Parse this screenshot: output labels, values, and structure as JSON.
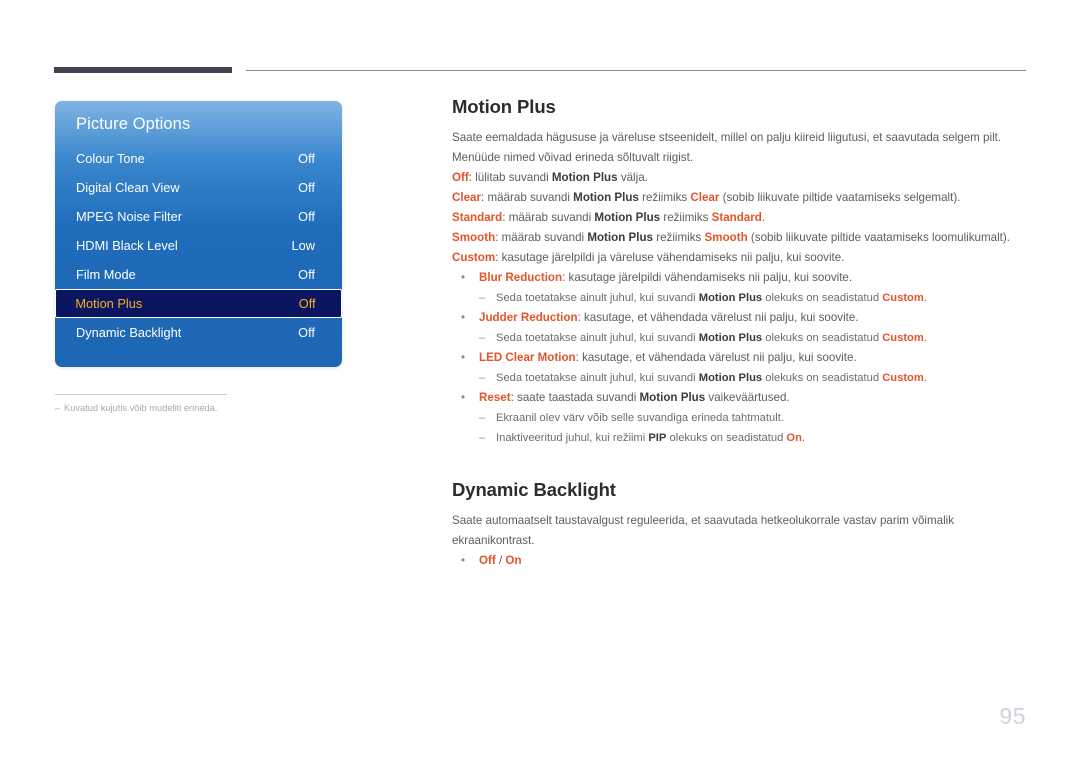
{
  "colors": {
    "accent": "#e4542b",
    "osd_selected_bg": "#0c1560",
    "osd_selected_text": "#f0b323",
    "header_bar": "#454350",
    "page_number": "#d2d2da"
  },
  "osd": {
    "title": "Picture Options",
    "rows": [
      {
        "label": "Colour Tone",
        "value": "Off",
        "selected": false
      },
      {
        "label": "Digital Clean View",
        "value": "Off",
        "selected": false
      },
      {
        "label": "MPEG Noise Filter",
        "value": "Off",
        "selected": false
      },
      {
        "label": "HDMI Black Level",
        "value": "Low",
        "selected": false
      },
      {
        "label": "Film Mode",
        "value": "Off",
        "selected": false
      },
      {
        "label": "Motion Plus",
        "value": "Off",
        "selected": true
      },
      {
        "label": "Dynamic Backlight",
        "value": "Off",
        "selected": false
      }
    ]
  },
  "footnote": {
    "dash": "–",
    "text": "Kuvatud kujutis võib mudeliti erineda."
  },
  "sections": {
    "motion_plus": {
      "heading": "Motion Plus",
      "intro_1": "Saate eemaldada hägususe ja väreluse stseenidelt, millel on palju kiireid liigutusi, et saavutada selgem pilt.",
      "intro_2": "Menüüde nimed võivad erineda sõltuvalt riigist.",
      "modes": [
        {
          "term": "Off",
          "mid": ": lülitab suvandi ",
          "ref": "Motion Plus",
          "tail": " välja."
        },
        {
          "term": "Clear",
          "mid": ": määrab suvandi ",
          "ref": "Motion Plus",
          "mid2": " režiimiks ",
          "term2": "Clear",
          "tail": " (sobib liikuvate piltide vaatamiseks selgemalt)."
        },
        {
          "term": "Standard",
          "mid": ": määrab suvandi ",
          "ref": "Motion Plus",
          "mid2": " režiimiks ",
          "term2": "Standard",
          "tail": "."
        },
        {
          "term": "Smooth",
          "mid": ": määrab suvandi ",
          "ref": "Motion Plus",
          "mid2": " režiimiks ",
          "term2": "Smooth",
          "tail": " (sobib liikuvate piltide vaatamiseks loomulikumalt)."
        },
        {
          "term": "Custom",
          "mid": ": kasutage järelpildi ja väreluse vähendamiseks nii palju, kui soovite.",
          "ref": "",
          "tail": ""
        }
      ],
      "bullets": [
        {
          "marker": "•",
          "term": "Blur Reduction",
          "text": ": kasutage järelpildi vähendamiseks nii palju, kui soovite.",
          "sub": [
            {
              "marker": "–",
              "pre": "Seda toetatakse ainult juhul, kui suvandi ",
              "ref": "Motion Plus",
              "mid": " olekuks on seadistatud ",
              "ref2": "Custom",
              "tail": "."
            }
          ]
        },
        {
          "marker": "•",
          "term": "Judder Reduction",
          "text": ": kasutage, et vähendada värelust nii palju, kui soovite.",
          "sub": [
            {
              "marker": "–",
              "pre": "Seda toetatakse ainult juhul, kui suvandi ",
              "ref": "Motion Plus",
              "mid": " olekuks on seadistatud ",
              "ref2": "Custom",
              "tail": "."
            }
          ]
        },
        {
          "marker": "•",
          "term": "LED Clear Motion",
          "text": ": kasutage, et vähendada värelust nii palju, kui soovite.",
          "sub": [
            {
              "marker": "–",
              "pre": "Seda toetatakse ainult juhul, kui suvandi ",
              "ref": "Motion Plus",
              "mid": " olekuks on seadistatud ",
              "ref2": "Custom",
              "tail": "."
            }
          ]
        },
        {
          "marker": "•",
          "term": "Reset",
          "text": ": saate taastada suvandi ",
          "ref": "Motion Plus",
          "text_tail": " vaikeväärtused.",
          "sub": [
            {
              "marker": "–",
              "pre": "Ekraanil olev värv võib selle suvandiga erineda tahtmatult.",
              "ref": "",
              "mid": "",
              "ref2": "",
              "tail": ""
            },
            {
              "marker": "–",
              "pre": "Inaktiveeritud juhul, kui režiimi ",
              "ref": "PIP",
              "mid": " olekuks on seadistatud ",
              "ref2": "On",
              "tail": "."
            }
          ]
        }
      ]
    },
    "dynamic_backlight": {
      "heading": "Dynamic Backlight",
      "intro": "Saate automaatselt taustavalgust reguleerida, et saavutada hetkeolukorrale vastav parim võimalik ekraanikontrast.",
      "option_marker": "•",
      "option_a": "Off",
      "option_sep": " / ",
      "option_b": "On"
    }
  },
  "page_number": "95"
}
